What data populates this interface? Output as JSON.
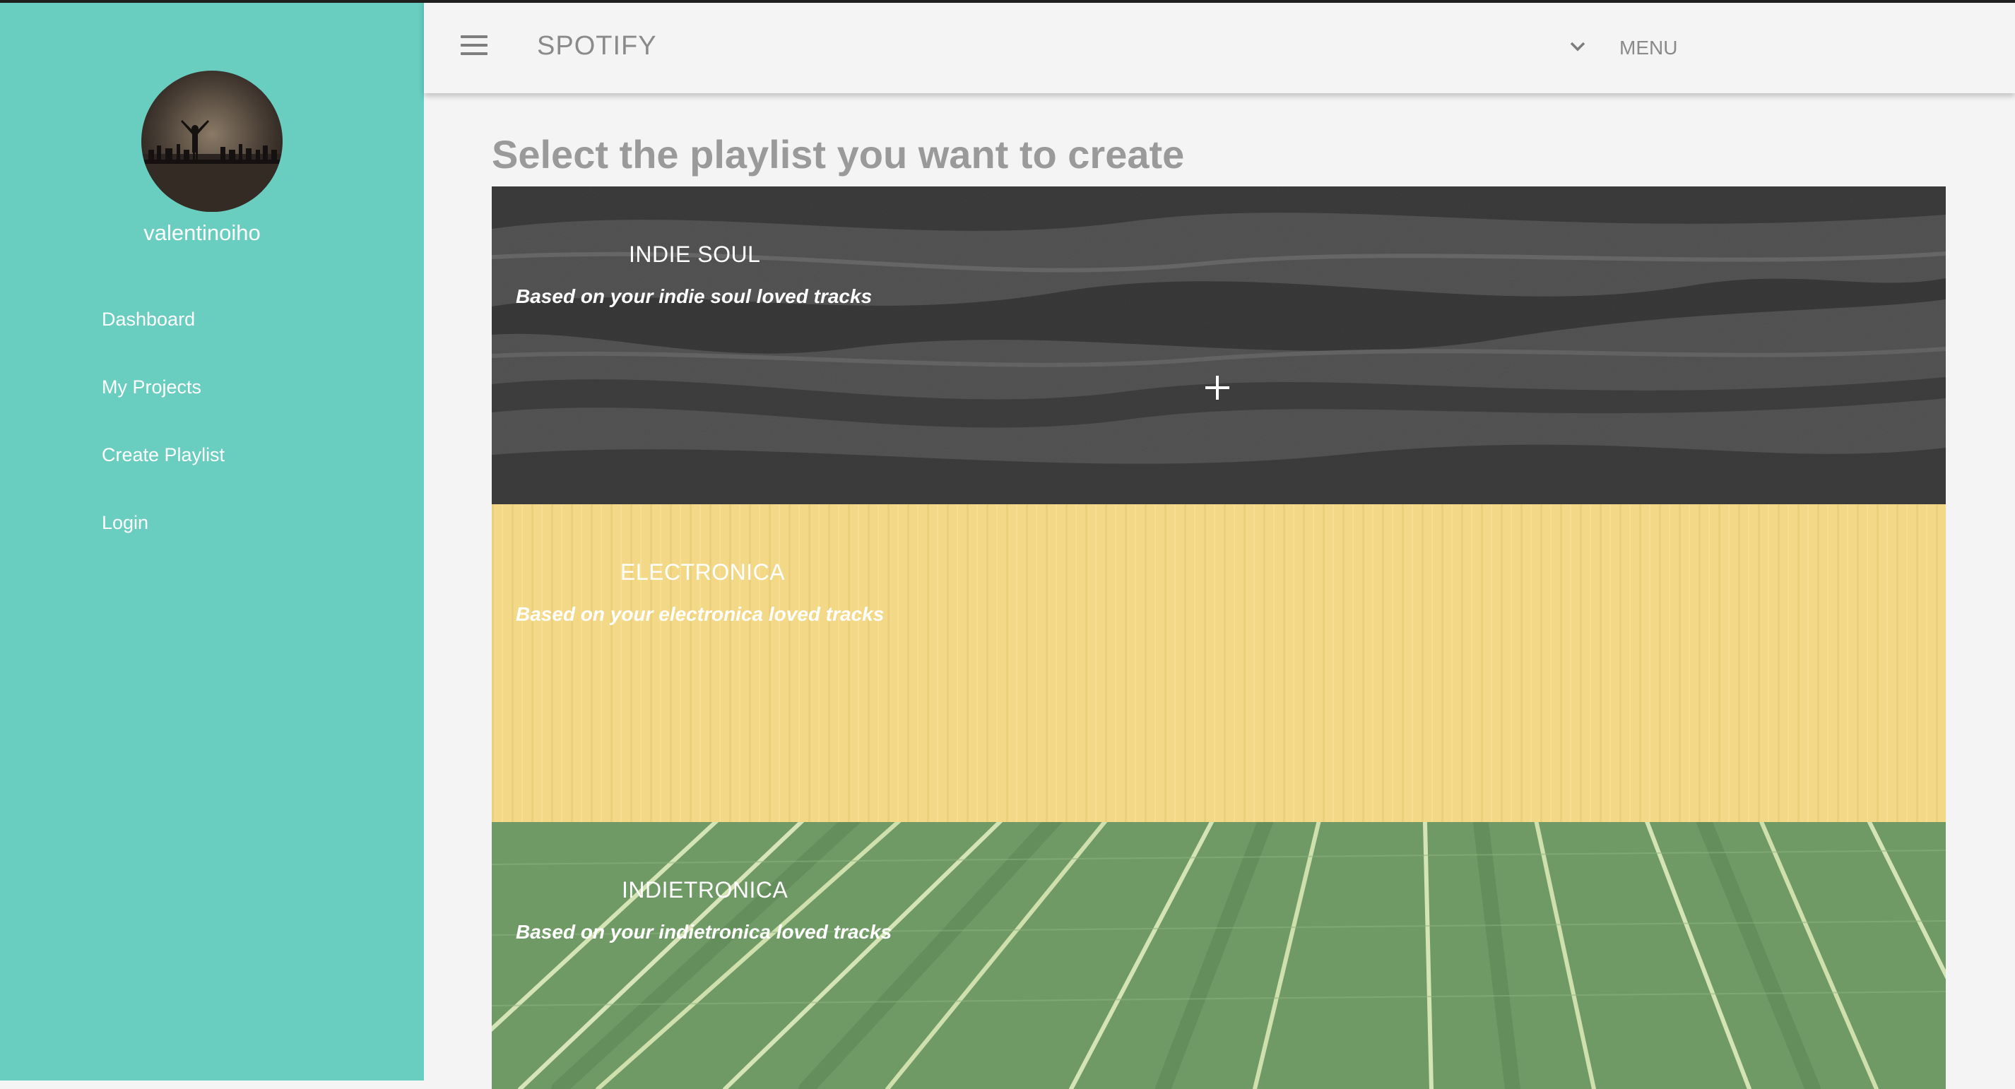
{
  "app": {
    "brand": "SPOTIFY",
    "menu_label": "MENU",
    "hamburger_icon": "hamburger-menu-icon",
    "chevron_icon": "chevron-down-icon"
  },
  "sidebar": {
    "username": "valentinoiho",
    "accent_color": "#69cdbf",
    "items": [
      {
        "label": "Dashboard"
      },
      {
        "label": "My Projects"
      },
      {
        "label": "Create Playlist"
      },
      {
        "label": "Login"
      }
    ]
  },
  "main": {
    "title": "Select the playlist you want to create",
    "playlists": [
      {
        "name": "INDIE SOUL",
        "description": "Based on your indie soul loved tracks",
        "background": "dark-sand"
      },
      {
        "name": "ELECTRONICA",
        "description": "Based on your electronica loved tracks",
        "background": "yellow-corrugated"
      },
      {
        "name": "INDIETRONICA",
        "description": "Based on your indietronica loved tracks",
        "background": "green-palm-leaf"
      }
    ],
    "add_icon": "plus-icon"
  }
}
